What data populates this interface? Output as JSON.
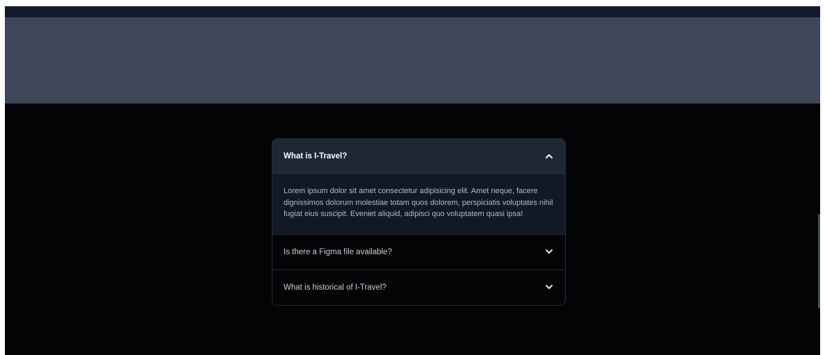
{
  "faq": {
    "items": [
      {
        "question": "What is I-Travel?",
        "expanded": true,
        "toggle_icon": "chevron-up-icon",
        "answer": "Lorem ipsum dolor sit amet consectetur adipisicing elit. Amet neque, facere dignissimos dolorum molestiae totam quos dolorem, perspiciatis voluptates nihil fugiat eius suscipit. Eveniet aliquid, adipisci quo voluptatem quasi ipsa!"
      },
      {
        "question": "Is there a Figma file available?",
        "expanded": false,
        "toggle_icon": "chevron-down-icon"
      },
      {
        "question": "What is historical of I-Travel?",
        "expanded": false,
        "toggle_icon": "chevron-down-icon"
      }
    ]
  },
  "colors": {
    "page_background": "#030406",
    "top_strip": "#121a2b",
    "banner": "#3d4759",
    "open_header": "#1e2736",
    "open_body": "#111827"
  }
}
